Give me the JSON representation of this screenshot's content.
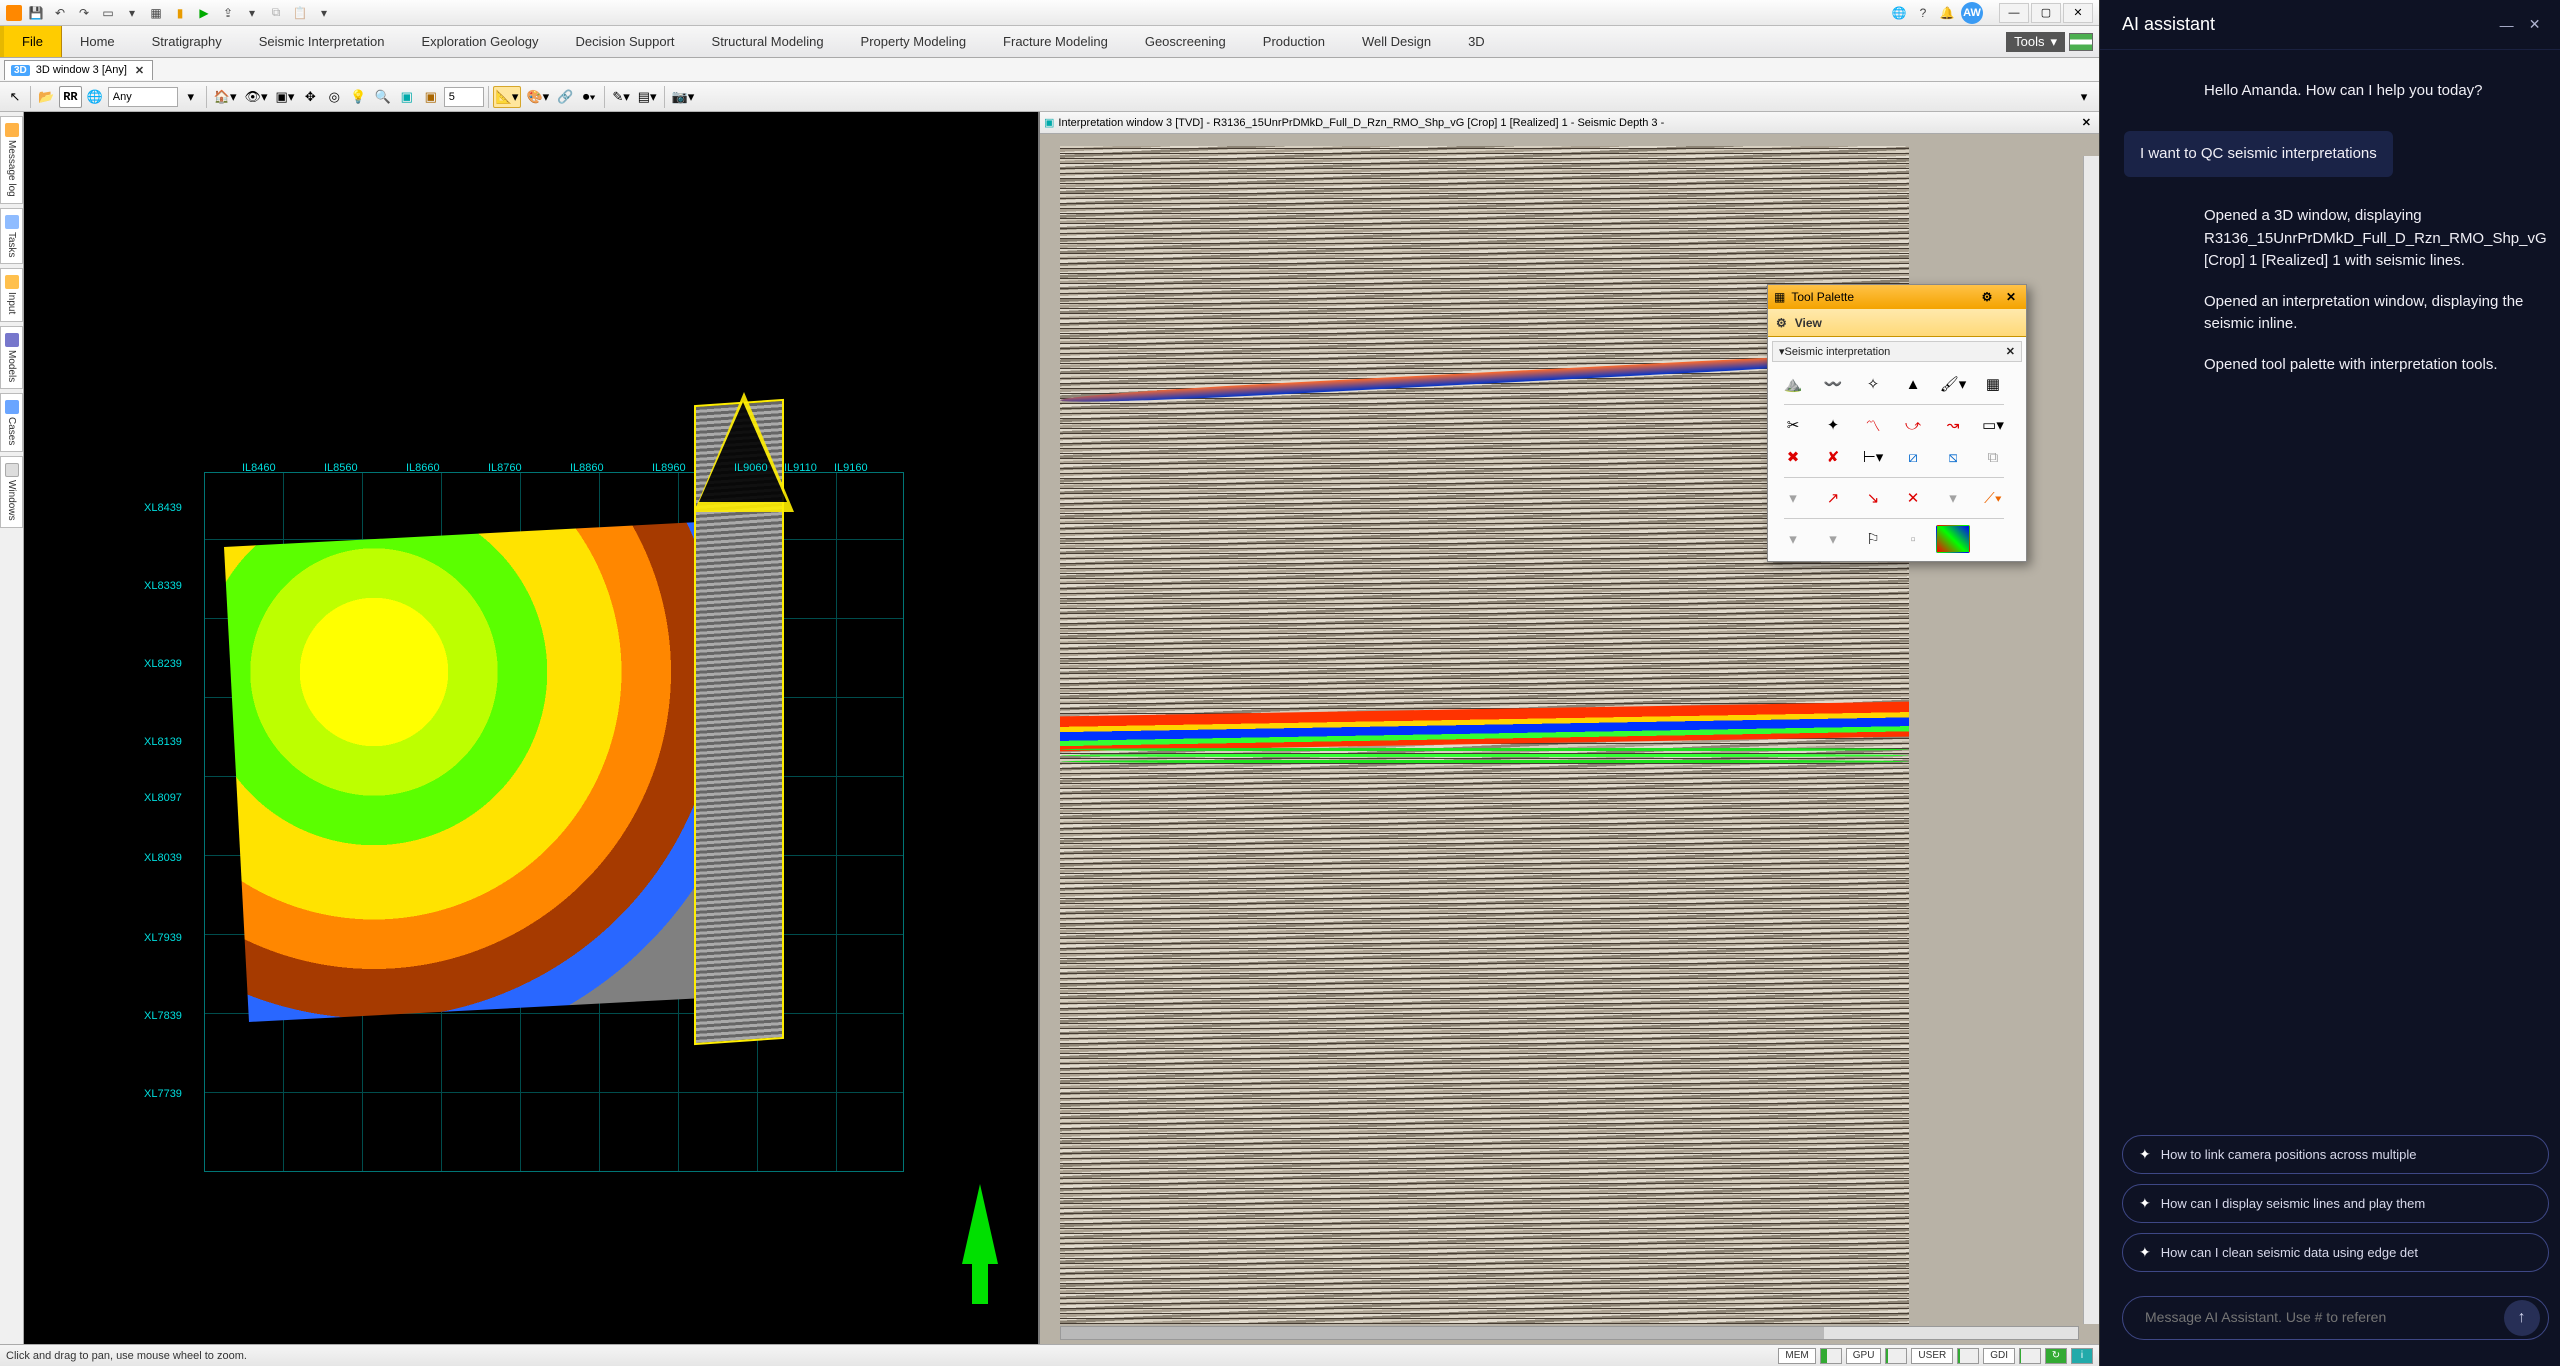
{
  "qat": {
    "avatar_initials": "AW"
  },
  "ribbon": {
    "tabs": [
      "File",
      "Home",
      "Stratigraphy",
      "Seismic Interpretation",
      "Exploration Geology",
      "Decision Support",
      "Structural Modeling",
      "Property Modeling",
      "Fracture Modeling",
      "Geoscreening",
      "Production",
      "Well Design",
      "3D"
    ],
    "tools_label": "Tools"
  },
  "doc_tab": {
    "badge": "3D",
    "title": "3D window 3 [Any]"
  },
  "toolbar": {
    "dropdown": "Any",
    "spin": "5"
  },
  "pane_left": {
    "il_ticks": [
      "IL8460",
      "IL8560",
      "IL8660",
      "IL8760",
      "IL8860",
      "IL8960",
      "IL9060",
      "IL9110",
      "IL9160"
    ],
    "xl_ticks": [
      "XL8439",
      "XL8339",
      "XL8239",
      "XL8139",
      "XL8097",
      "XL8039",
      "XL7939",
      "XL7839",
      "XL7739"
    ]
  },
  "interp": {
    "title": "Interpretation window 3 [TVD] - R3136_15UnrPrDMkD_Full_D_Rzn_RMO_Shp_vG [Crop] 1 [Realized] 1 - Seismic Depth 3 -"
  },
  "tool_palette": {
    "title": "Tool Palette",
    "view": "View",
    "section": "Seismic interpretation"
  },
  "sidebar_tabs": [
    "Message log",
    "Tasks",
    "Input",
    "Models",
    "Cases",
    "Windows"
  ],
  "status": {
    "hint": "Click and drag to pan, use mouse wheel to zoom.",
    "mem": "MEM",
    "gpu": "GPU",
    "user": "USER",
    "gdi": "GDI"
  },
  "ai": {
    "title": "AI assistant",
    "greeting": "Hello Amanda. How can I help you today?",
    "user_msg": "I want to QC seismic interpretations",
    "reply_p1": "Opened a 3D window, displaying R3136_15UnrPrDMkD_Full_D_Rzn_RMO_Shp_vG [Crop] 1 [Realized] 1 with seismic lines.",
    "reply_p2": "Opened an interpretation window, displaying the seismic inline.",
    "reply_p3": "Opened tool palette with interpretation tools.",
    "suggestions": [
      "How to link camera positions across multiple",
      "How can I display seismic lines and play them",
      "How can I clean seismic data using edge det"
    ],
    "placeholder": "Message AI Assistant. Use # to referen"
  }
}
